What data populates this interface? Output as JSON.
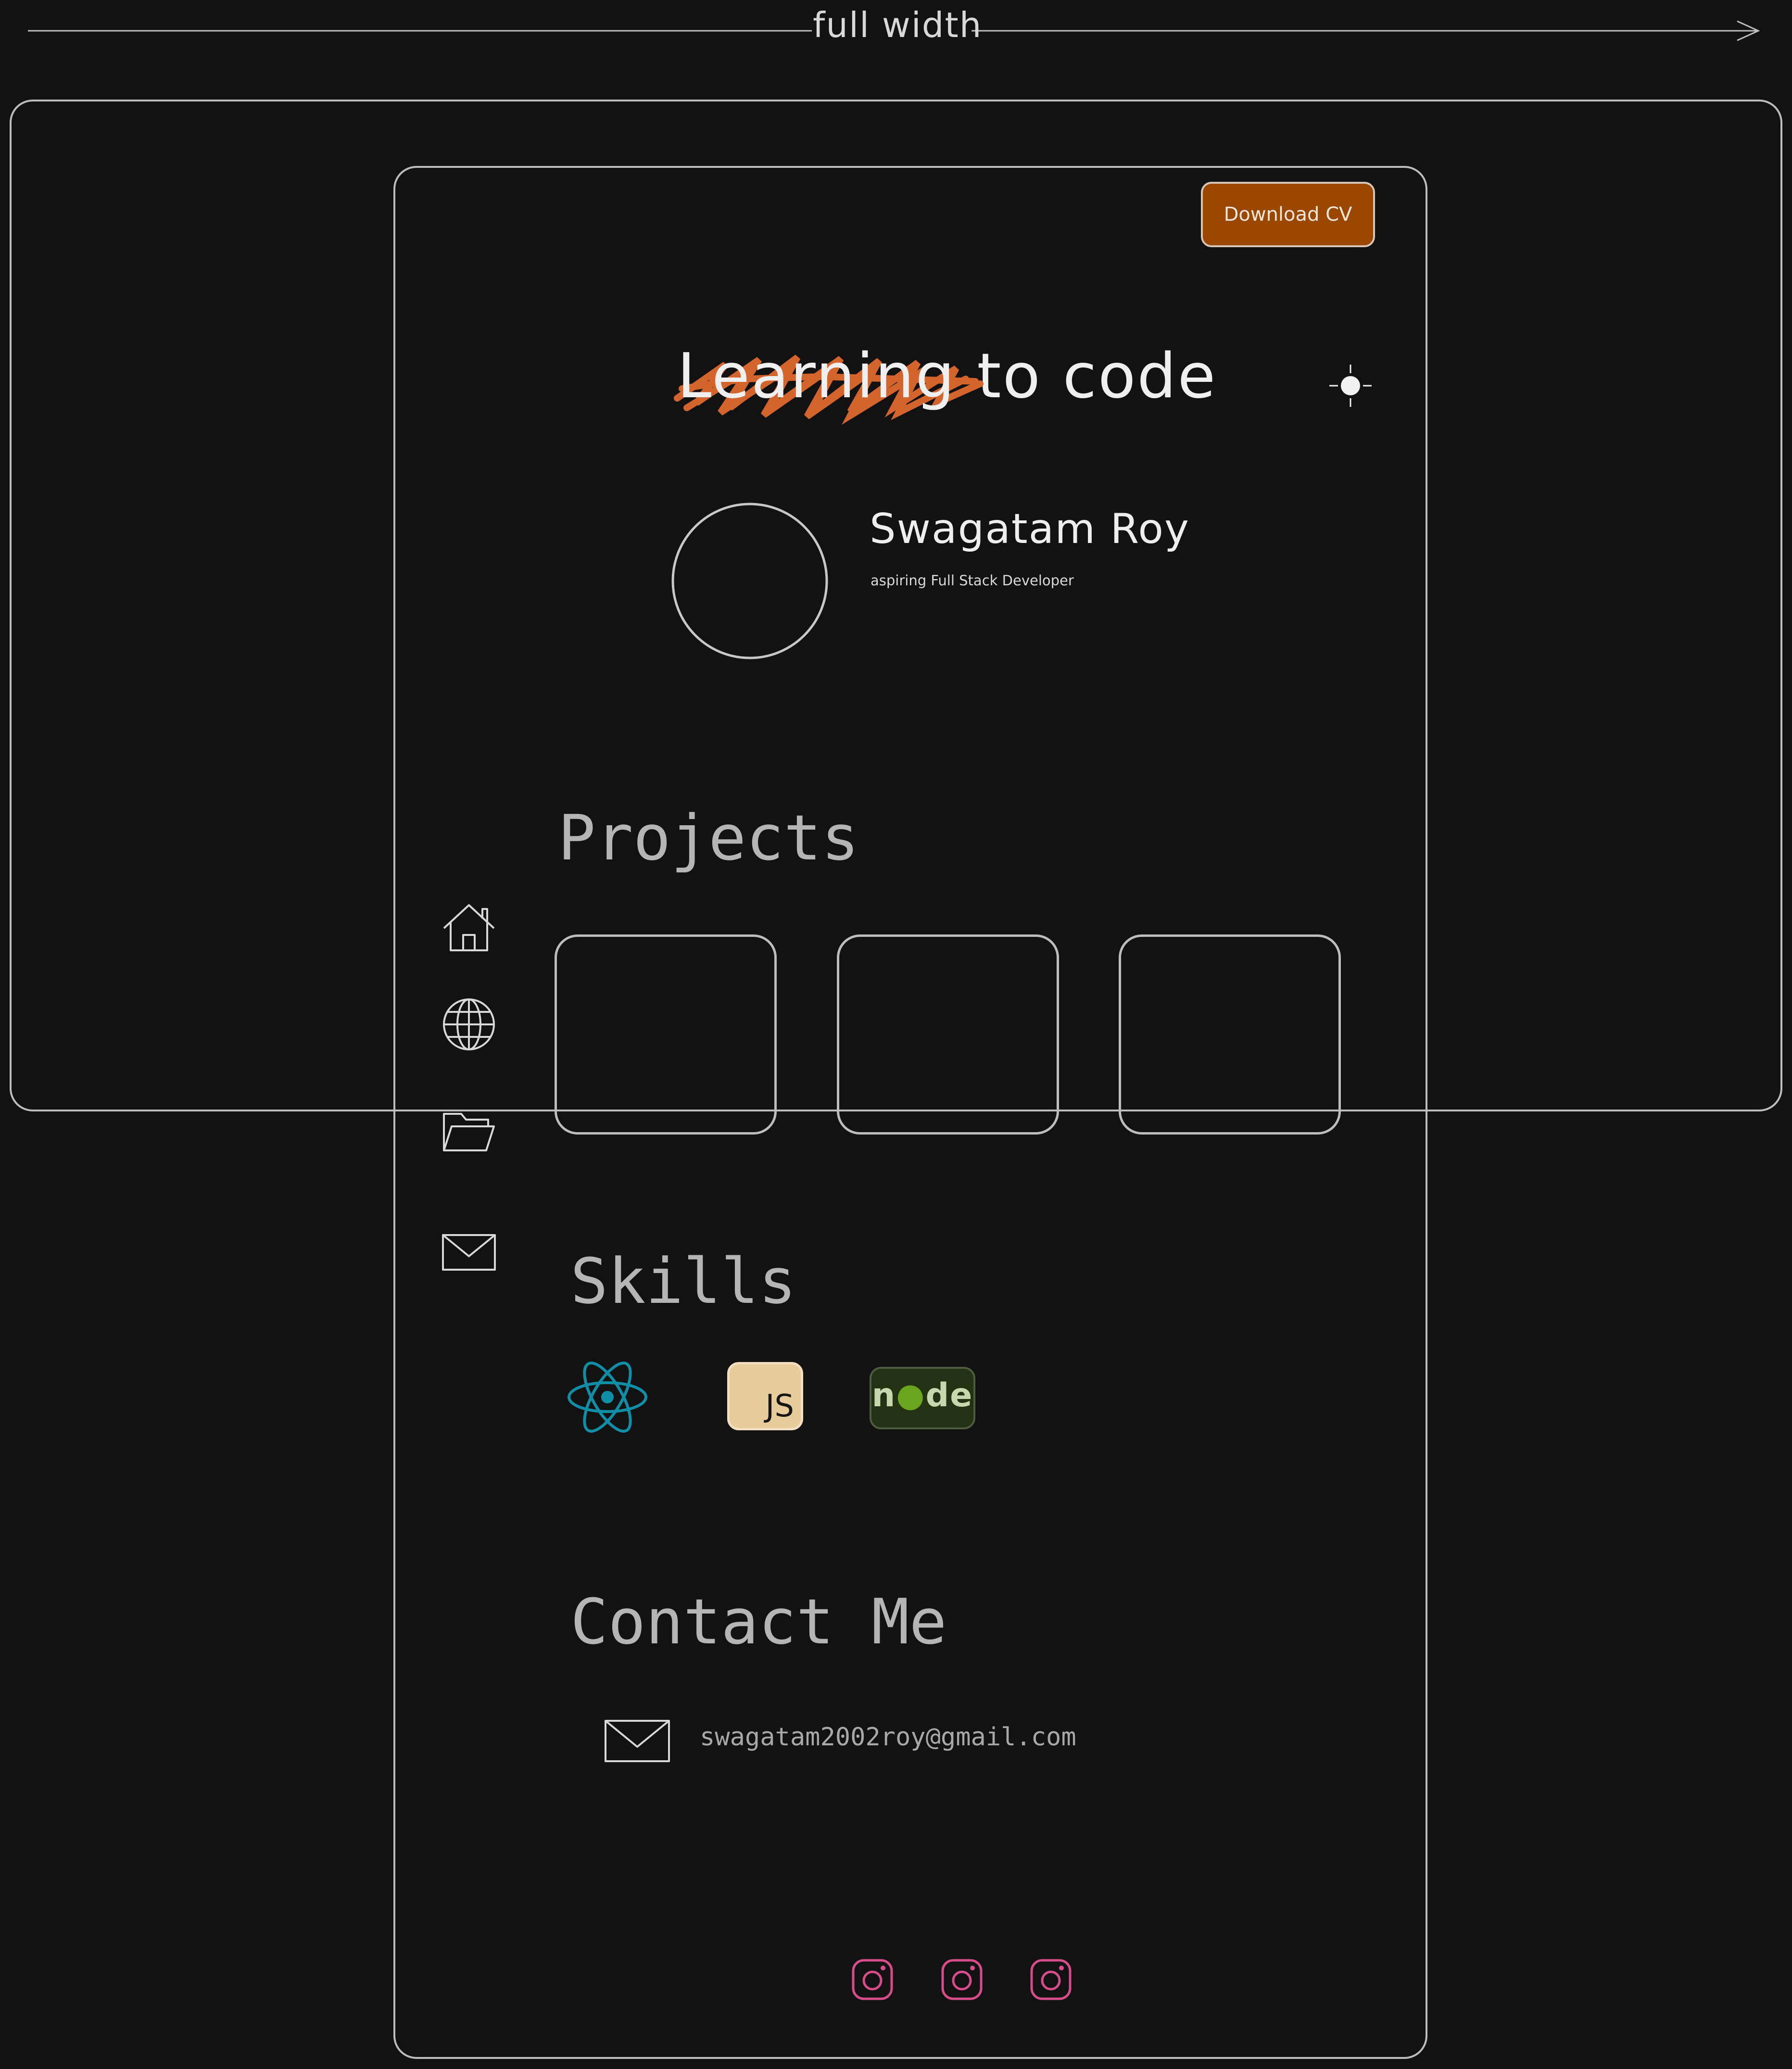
{
  "annotation": {
    "width_label": "full width"
  },
  "header": {
    "download_label": "Download CV",
    "theme_icon": "sun-icon"
  },
  "hero": {
    "struck_word": "Learning",
    "rest": "to code",
    "scribble_color": "#d2642c"
  },
  "profile": {
    "name": "Swagatam Roy",
    "tagline": "aspiring Full Stack Developer"
  },
  "nav": {
    "icons": [
      "home-icon",
      "globe-icon",
      "folder-icon",
      "mail-icon"
    ]
  },
  "projects": {
    "title": "Projects",
    "cards": 3
  },
  "skills": {
    "title": "Skills",
    "items": [
      {
        "name": "React",
        "icon": "react-icon",
        "color": "#0f8fa6"
      },
      {
        "name": "JavaScript",
        "icon": "js-icon",
        "label": "JS",
        "color": "#e6cb9b"
      },
      {
        "name": "Node",
        "icon": "node-icon",
        "label_parts": [
          "n",
          "●",
          "de"
        ],
        "color": "#243214"
      }
    ]
  },
  "contact": {
    "title": "Contact Me",
    "email": "swagatam2002roy@gmail.com",
    "icon": "mail-icon"
  },
  "socials": {
    "icons": [
      "instagram-icon",
      "instagram-icon",
      "instagram-icon"
    ],
    "color": "#d94c8a"
  },
  "colors": {
    "background": "#121212",
    "accent": "#9a4700",
    "stroke": "#bdbdbd"
  }
}
